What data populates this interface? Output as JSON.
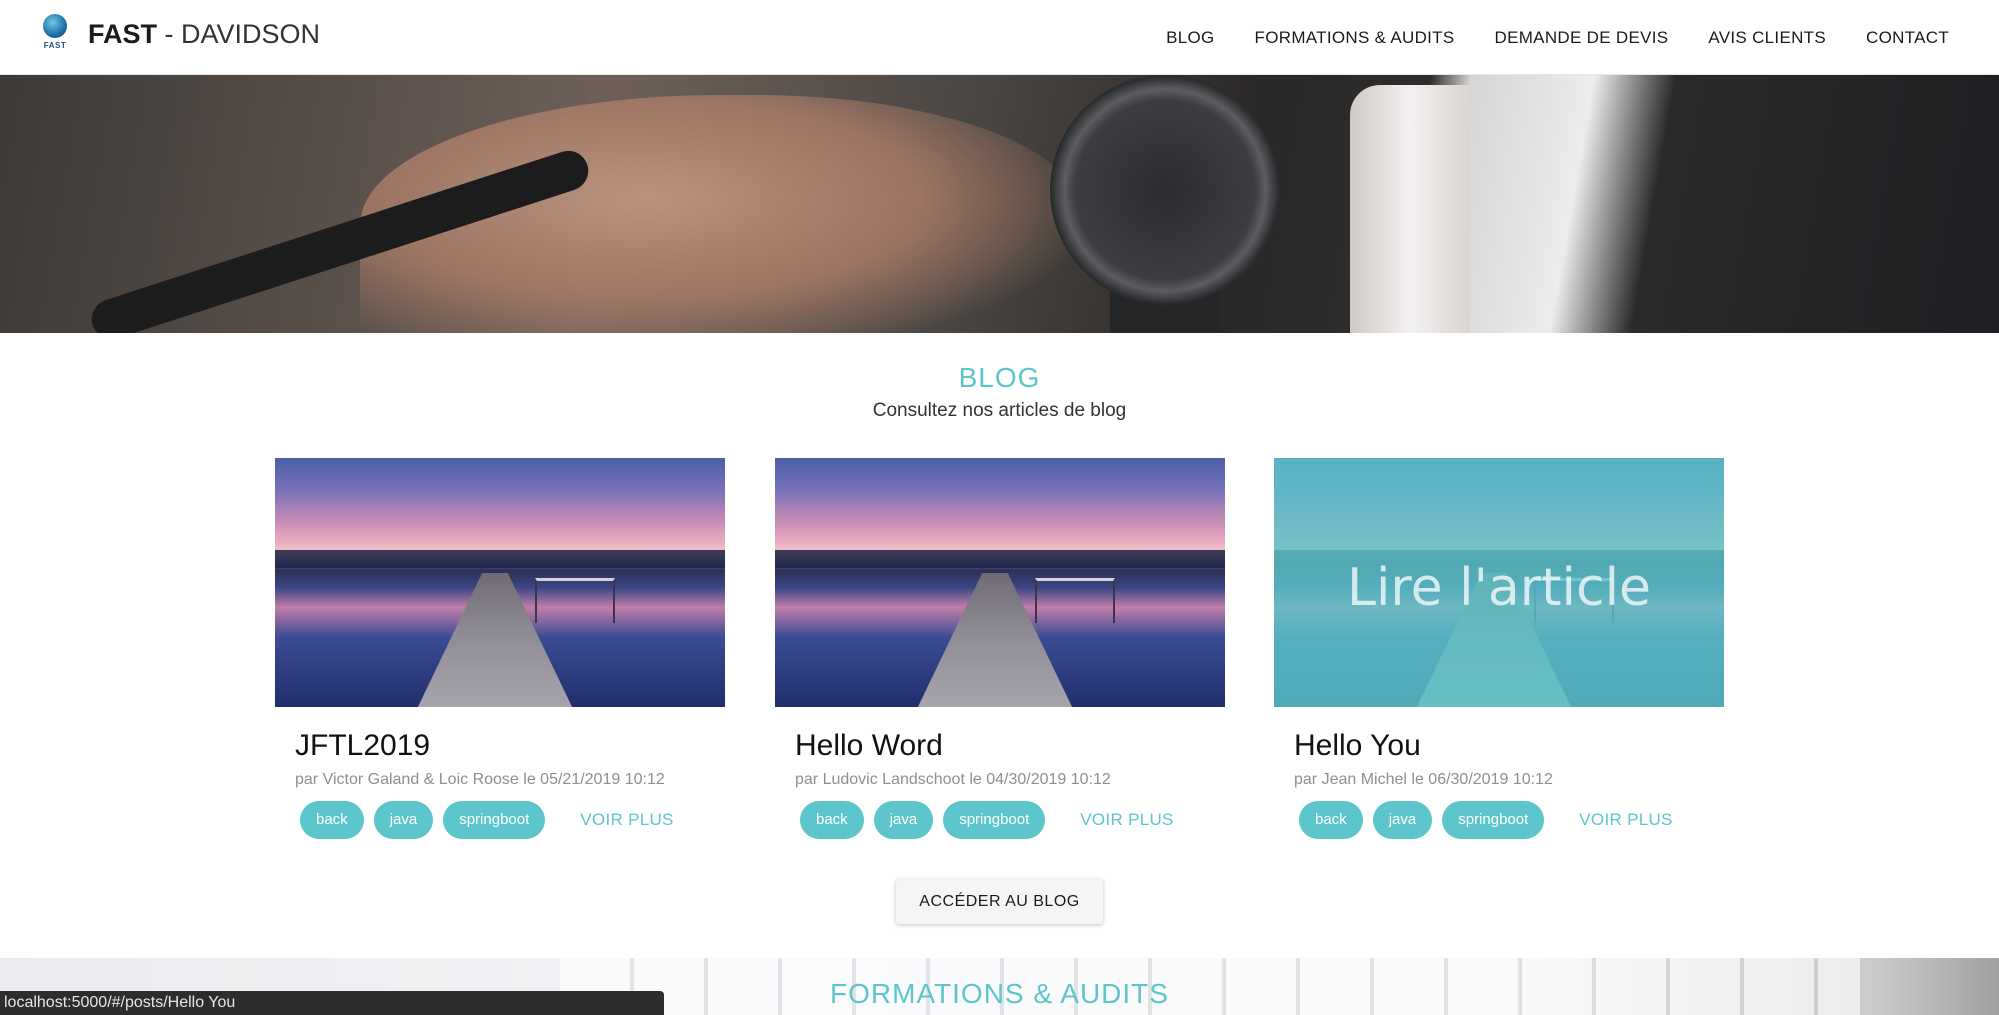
{
  "header": {
    "logo_small": "FAST",
    "brand_bold": "FAST",
    "brand_rest": "- DAVIDSON",
    "nav": [
      "BLOG",
      "FORMATIONS & AUDITS",
      "DEMANDE DE DEVIS",
      "AVIS CLIENTS",
      "CONTACT"
    ]
  },
  "blog": {
    "title": "BLOG",
    "subtitle": "Consultez nos articles de blog",
    "cards": [
      {
        "title": "JFTL2019",
        "meta": "par Victor Galand & Loic Roose le 05/21/2019 10:12",
        "tags": [
          "back",
          "java",
          "springboot"
        ],
        "more": "VOIR PLUS"
      },
      {
        "title": "Hello Word",
        "meta": "par Ludovic Landschoot le 04/30/2019 10:12",
        "tags": [
          "back",
          "java",
          "springboot"
        ],
        "more": "VOIR PLUS"
      },
      {
        "title": "Hello You",
        "meta": "par Jean Michel le 06/30/2019 10:12",
        "tags": [
          "back",
          "java",
          "springboot"
        ],
        "more": "VOIR PLUS",
        "overlay": "Lire l'article"
      }
    ],
    "access_button": "ACCÉDER AU BLOG"
  },
  "formations": {
    "title": "FORMATIONS & AUDITS"
  },
  "status_bar": "localhost:5000/#/posts/Hello You",
  "colors": {
    "accent": "#5cc6cc",
    "text": "#1b1b1b",
    "meta": "#8f8f8f"
  }
}
